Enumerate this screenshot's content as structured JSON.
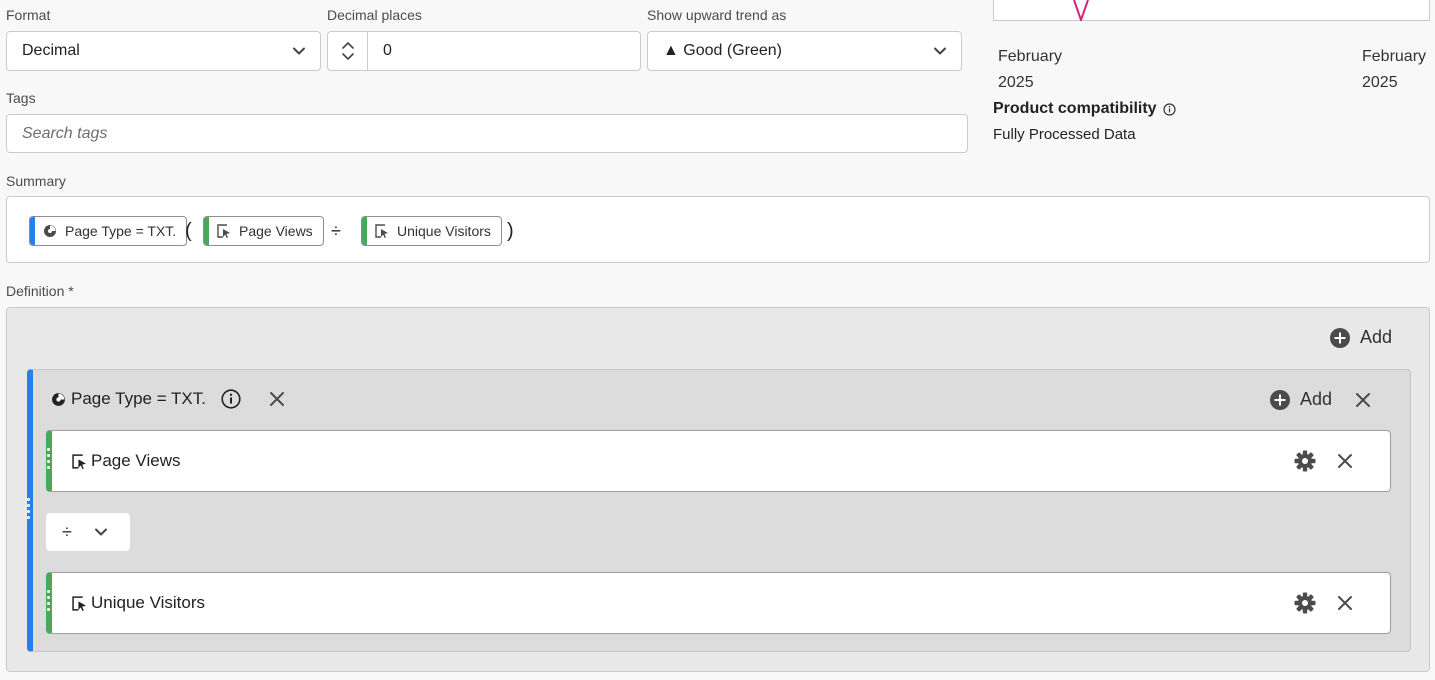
{
  "format": {
    "label": "Format",
    "value": "Decimal"
  },
  "decimal_places": {
    "label": "Decimal places",
    "value": "0"
  },
  "upward_trend": {
    "label": "Show upward trend as",
    "value": "▲ Good (Green)"
  },
  "tags": {
    "label": "Tags",
    "placeholder": "Search tags"
  },
  "preview": {
    "date_start_month": "February",
    "date_start_year": "2025",
    "date_end_month": "February",
    "date_end_year": "2025",
    "sparkline_color": "#d4247a"
  },
  "compatibility": {
    "title": "Product compatibility",
    "value": "Fully Processed Data"
  },
  "summary": {
    "label": "Summary",
    "chips": [
      {
        "label": "Page Type = TXT.",
        "color": "#2680eb"
      },
      {
        "label": "Page Views",
        "color": "#4aa85a"
      },
      {
        "label": "Unique Visitors",
        "color": "#4aa85a"
      }
    ],
    "open_paren": "(",
    "operator": "÷",
    "close_paren": ")"
  },
  "definition": {
    "label": "Definition",
    "required_mark": "*",
    "add_label": "Add",
    "container": {
      "title": "Page Type = TXT.",
      "add_label": "Add",
      "metrics": [
        {
          "name": "Page Views"
        },
        {
          "name": "Unique Visitors"
        }
      ],
      "operator": "÷"
    }
  },
  "colors": {
    "segment": "#2680eb",
    "metric": "#4aa85a",
    "border": "#cacaca"
  }
}
